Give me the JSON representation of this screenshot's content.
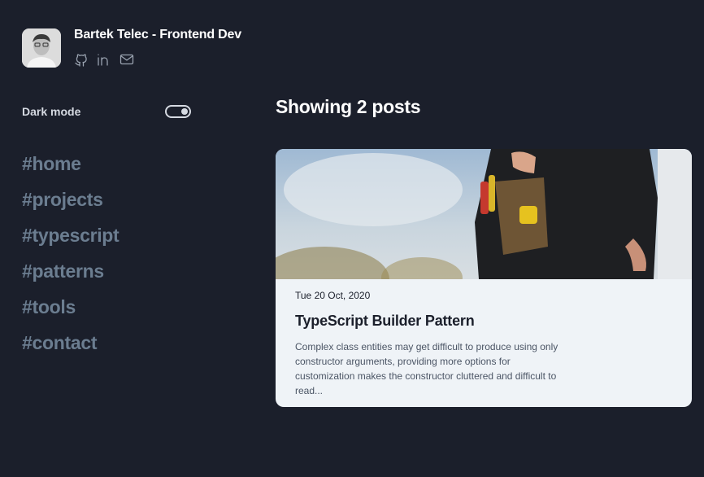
{
  "profile": {
    "author": "Bartek Telec - Frontend Dev",
    "socials": [
      {
        "icon": "github-icon"
      },
      {
        "icon": "linkedin-icon"
      },
      {
        "icon": "mail-icon"
      }
    ]
  },
  "sidebar": {
    "dark_mode_label": "Dark mode",
    "dark_mode_on": true,
    "nav": [
      "#home",
      "#projects",
      "#typescript",
      "#patterns",
      "#tools",
      "#contact"
    ]
  },
  "main": {
    "heading": "Showing 2 posts",
    "posts": [
      {
        "date": "Tue 20 Oct, 2020",
        "title": "TypeScript Builder Pattern",
        "excerpt": "Complex class entities may get difficult to produce using only constructor arguments, providing more options for customization makes the constructor cluttered and difficult to read..."
      }
    ]
  },
  "colors": {
    "background": "#1b1f2b",
    "nav_text": "#6b7d90",
    "card_bg": "#eff3f7"
  }
}
